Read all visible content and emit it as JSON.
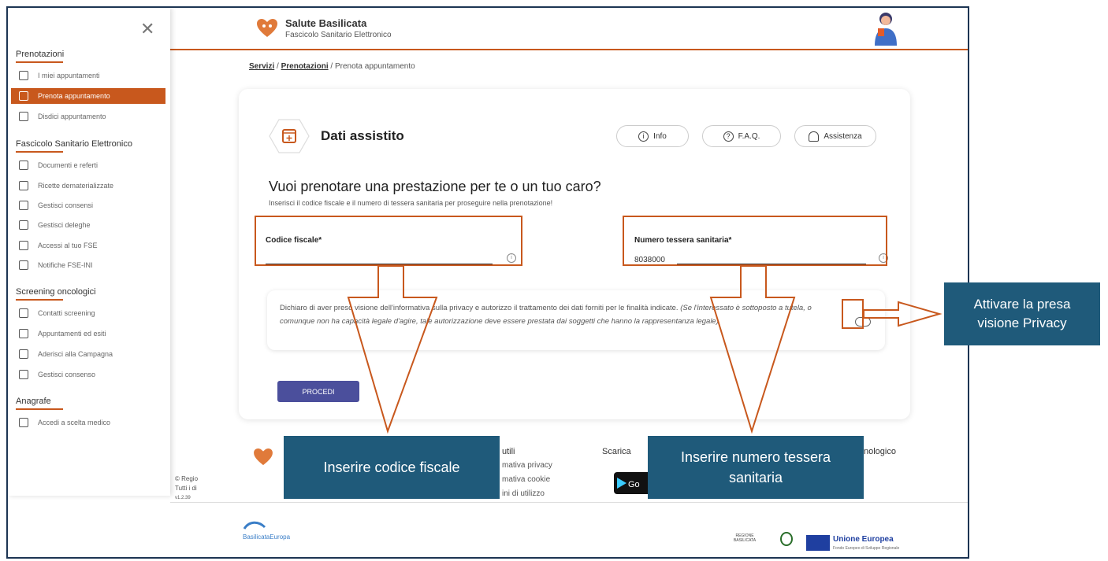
{
  "sidebar": {
    "sections": [
      {
        "title": "Prenotazioni",
        "items": [
          "I miei appuntamenti",
          "Prenota appuntamento",
          "Disdici appuntamento"
        ]
      },
      {
        "title": "Fascicolo Sanitario Elettronico",
        "items": [
          "Documenti e referti",
          "Ricette dematerializzate",
          "Gestisci consensi",
          "Gestisci deleghe",
          "Accessi al tuo FSE",
          "Notifiche FSE-INI"
        ]
      },
      {
        "title": "Screening oncologici",
        "items": [
          "Contatti screening",
          "Appuntamenti ed esiti",
          "Aderisci alla Campagna",
          "Gestisci consenso"
        ]
      },
      {
        "title": "Anagrafe",
        "items": [
          "Accedi a scelta medico"
        ]
      }
    ],
    "active_item": "Prenota appuntamento"
  },
  "header": {
    "title": "Salute Basilicata",
    "subtitle": "Fascicolo Sanitario Elettronico"
  },
  "breadcrumb": {
    "l1": "Servizi",
    "l2": "Prenotazioni",
    "current": "Prenota appuntamento",
    "sep": "/"
  },
  "card": {
    "title": "Dati assistito",
    "buttons": {
      "info": "Info",
      "faq": "F.A.Q.",
      "assist": "Assistenza"
    },
    "question": "Vuoi prenotare una prestazione per te o un tuo caro?",
    "hint": "Inserisci il codice fiscale e il numero di tessera sanitaria per proseguire nella prenotazione!",
    "cf_label": "Codice fiscale*",
    "ts_label": "Numero tessera sanitaria*",
    "ts_value": "8038000",
    "consent_plain": "Dichiaro di aver preso visione dell'informativa sulla privacy e autorizzo il trattamento dei dati forniti per le finalità indicate. ",
    "consent_italic": "(Se l'interessato è sottoposto a tutela, o comunque non ha capacità legale d'agire, tale autorizzazione deve essere prestata dai soggetti che hanno la rappresentanza legale)",
    "procedi": "PROCEDI"
  },
  "footer": {
    "utili": "utili",
    "privacy": "mativa privacy",
    "cookie": "mativa cookie",
    "terms": "ini di utilizzo",
    "scarica": "Scarica",
    "nologico": "nologico",
    "copyright1": "© Regio",
    "copyright2": "Tutti i di",
    "version": "v1.2.39",
    "gplay": "Go",
    "fesr": "BasilicataEuropa",
    "eu": "Unione Europea",
    "eu_sub": "Fondo Europeo di Sviluppo Regionale",
    "regione": "REGIONE BASILICATA"
  },
  "callouts": {
    "privacy": "Attivare la presa visione Privacy",
    "cf": "Inserire codice fiscale",
    "ts": "Inserire numero tessera sanitaria"
  },
  "colors": {
    "accent": "#c8581d",
    "callout": "#1f5a7a",
    "button": "#4b4f9c"
  }
}
